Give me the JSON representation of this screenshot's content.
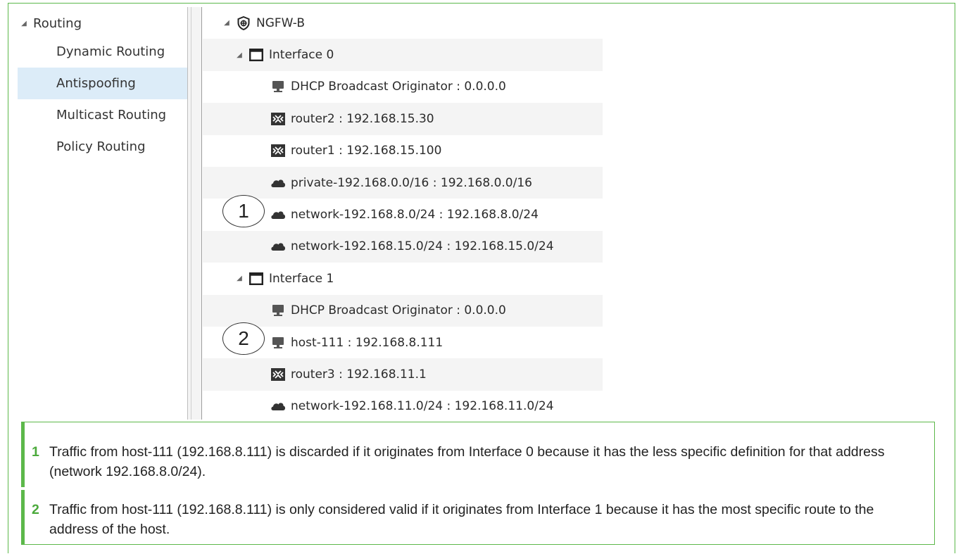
{
  "nav": {
    "header": "Routing",
    "items": [
      {
        "label": "Dynamic Routing",
        "selected": false
      },
      {
        "label": "Antispoofing",
        "selected": true
      },
      {
        "label": "Multicast Routing",
        "selected": false
      },
      {
        "label": "Policy Routing",
        "selected": false
      }
    ]
  },
  "tree": {
    "root": "NGFW-B",
    "interface0": {
      "label": "Interface 0",
      "items": [
        {
          "icon": "host-icon",
          "text": "DHCP Broadcast Originator : 0.0.0.0"
        },
        {
          "icon": "router-icon",
          "text": "router2 : 192.168.15.30"
        },
        {
          "icon": "router-icon",
          "text": "router1 : 192.168.15.100"
        },
        {
          "icon": "network-icon",
          "text": "private-192.168.0.0/16 : 192.168.0.0/16"
        },
        {
          "icon": "network-icon",
          "text": "network-192.168.8.0/24 : 192.168.8.0/24"
        },
        {
          "icon": "network-icon",
          "text": "network-192.168.15.0/24 : 192.168.15.0/24"
        }
      ]
    },
    "interface1": {
      "label": "Interface 1",
      "items": [
        {
          "icon": "host-icon",
          "text": "DHCP Broadcast Originator : 0.0.0.0"
        },
        {
          "icon": "host-icon",
          "text": "host-111 : 192.168.8.111"
        },
        {
          "icon": "router-icon",
          "text": "router3 : 192.168.11.1"
        },
        {
          "icon": "network-icon",
          "text": "network-192.168.11.0/24 : 192.168.11.0/24"
        }
      ]
    }
  },
  "callouts": [
    "1",
    "2"
  ],
  "notes": [
    {
      "num": "1",
      "text": "Traffic from host-111 (192.168.8.111) is discarded if it originates from Interface 0 because it has the less specific definition for that address (network 192.168.8.0/24)."
    },
    {
      "num": "2",
      "text": "Traffic from host-111 (192.168.8.111) is only considered valid if it originates from Interface 1 because it has the most specific route to the address of the host."
    }
  ],
  "colors": {
    "accent": "#5cb84a",
    "selected": "#dcecf8",
    "number": "#4caa3c"
  }
}
